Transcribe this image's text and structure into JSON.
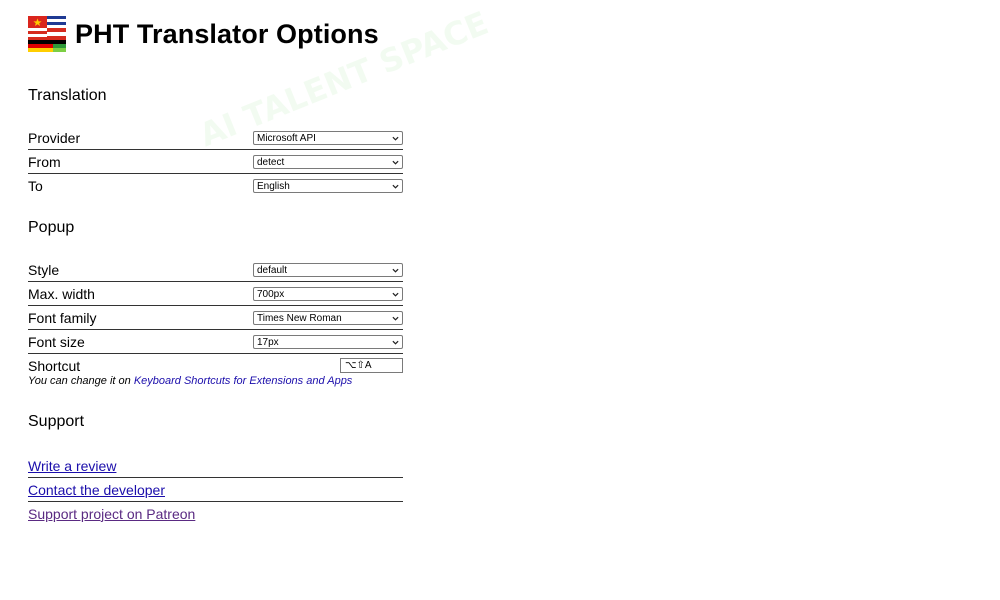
{
  "header": {
    "title": "PHT Translator Options"
  },
  "translation": {
    "title": "Translation",
    "rows": [
      {
        "label": "Provider",
        "value": "Microsoft API"
      },
      {
        "label": "From",
        "value": "detect"
      },
      {
        "label": "To",
        "value": "English"
      }
    ]
  },
  "popup": {
    "title": "Popup",
    "rows": [
      {
        "label": "Style",
        "value": "default"
      },
      {
        "label": "Max. width",
        "value": "700px"
      },
      {
        "label": "Font family",
        "value": "Times New Roman"
      },
      {
        "label": "Font size",
        "value": "17px"
      }
    ],
    "shortcut": {
      "label": "Shortcut",
      "value": "⌥⇧A",
      "hint_prefix": "You can change it on ",
      "hint_link": "Keyboard Shortcuts for Extensions and Apps"
    }
  },
  "support": {
    "title": "Support",
    "links": [
      {
        "label": "Write a review"
      },
      {
        "label": "Contact the developer"
      },
      {
        "label": "Support project on Patreon"
      }
    ]
  },
  "watermark": {
    "text": "AI TALENT SPACE"
  },
  "colors": {
    "link": "#1a0dab",
    "visited_link": "#5a2a82",
    "separator": "#333333"
  }
}
